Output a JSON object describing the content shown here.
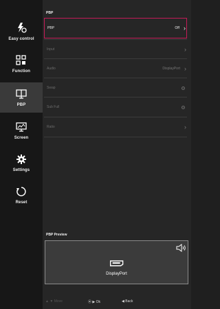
{
  "sidebar": {
    "items": [
      {
        "label": "Easy control",
        "icon": "lightning-gear-icon"
      },
      {
        "label": "Function",
        "icon": "function-grid-icon"
      },
      {
        "label": "PBP",
        "icon": "pbp-monitor-icon"
      },
      {
        "label": "Screen",
        "icon": "screen-monitor-icon"
      },
      {
        "label": "Settings",
        "icon": "gear-icon"
      },
      {
        "label": "Reset",
        "icon": "reset-icon"
      }
    ]
  },
  "main": {
    "section_title": "PBP",
    "rows": [
      {
        "name": "PBP",
        "value": "Off",
        "control": "chevron"
      },
      {
        "name": "Input",
        "value": "",
        "control": "chevron"
      },
      {
        "name": "Audio",
        "value": "DisplayPort",
        "control": "chevron"
      },
      {
        "name": "Swap",
        "value": "",
        "control": "radio"
      },
      {
        "name": "Sub Full",
        "value": "",
        "control": "radio"
      },
      {
        "name": "Ratio",
        "value": "",
        "control": "chevron"
      }
    ]
  },
  "preview": {
    "title": "PBP Preview",
    "port_label": "DisplayPort"
  },
  "footer": {
    "move_label": "Move",
    "ok_label": "Ok",
    "back_label": "Back"
  },
  "colors": {
    "accent": "#c51b57",
    "background": "#262626",
    "sidebar": "#171717",
    "active_item": "#3a3a3a"
  }
}
